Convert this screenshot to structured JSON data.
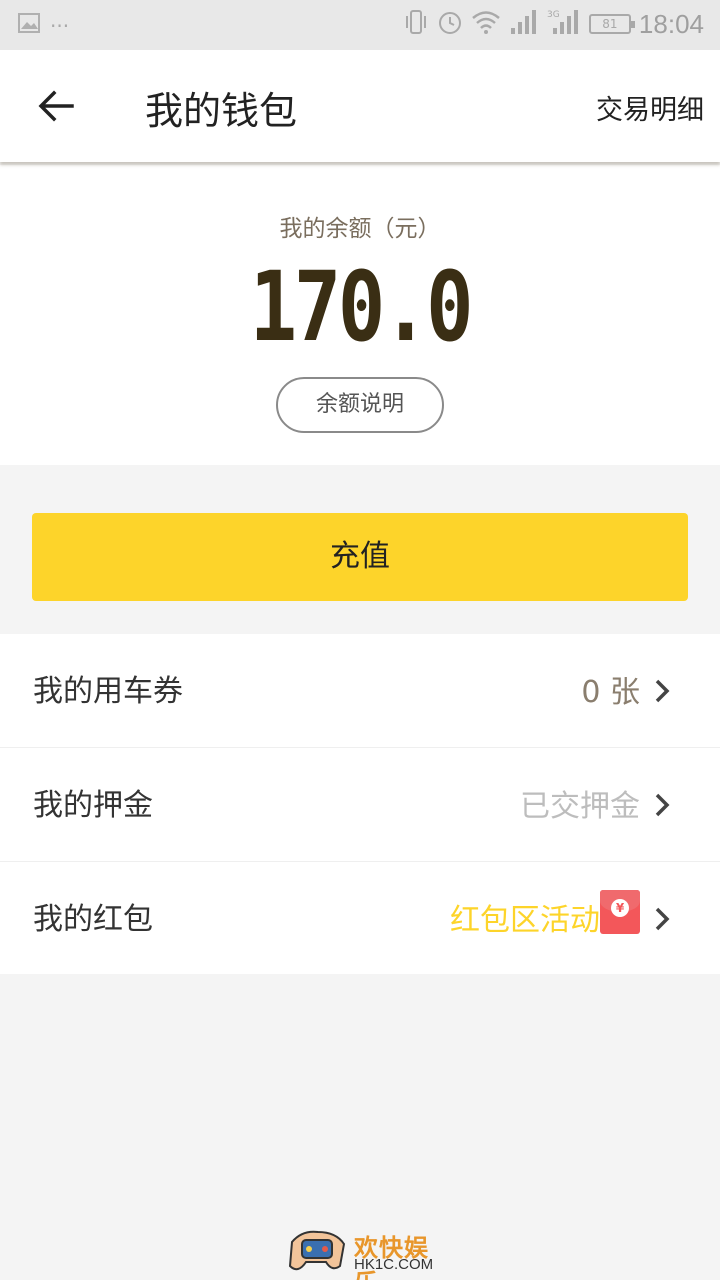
{
  "status_bar": {
    "time": "18:04",
    "battery": "81",
    "more": "···",
    "icons": [
      "image-icon",
      "vibrate-icon",
      "alarm-icon",
      "wifi-icon",
      "signal-icon",
      "signal-3g-icon",
      "battery-icon"
    ]
  },
  "header": {
    "title": "我的钱包",
    "detail_link": "交易明细",
    "back_icon": "arrow-left-icon"
  },
  "balance": {
    "label": "我的余额（元）",
    "amount": "170.0",
    "explain_button": "余额说明"
  },
  "recharge_button": "充值",
  "list": {
    "items": [
      {
        "label": "我的用车券",
        "value": "0 张"
      },
      {
        "label": "我的押金",
        "value": "已交押金"
      },
      {
        "label": "我的红包",
        "value": "红包区活动",
        "icon": "red-envelope-icon"
      }
    ]
  },
  "watermark": {
    "name": "欢快娱乐",
    "url": "HK1C.COM"
  },
  "colors": {
    "accent_yellow": "#fdd42a",
    "amount_brown": "#3a2e14",
    "red_envelope": "#f3575a"
  }
}
